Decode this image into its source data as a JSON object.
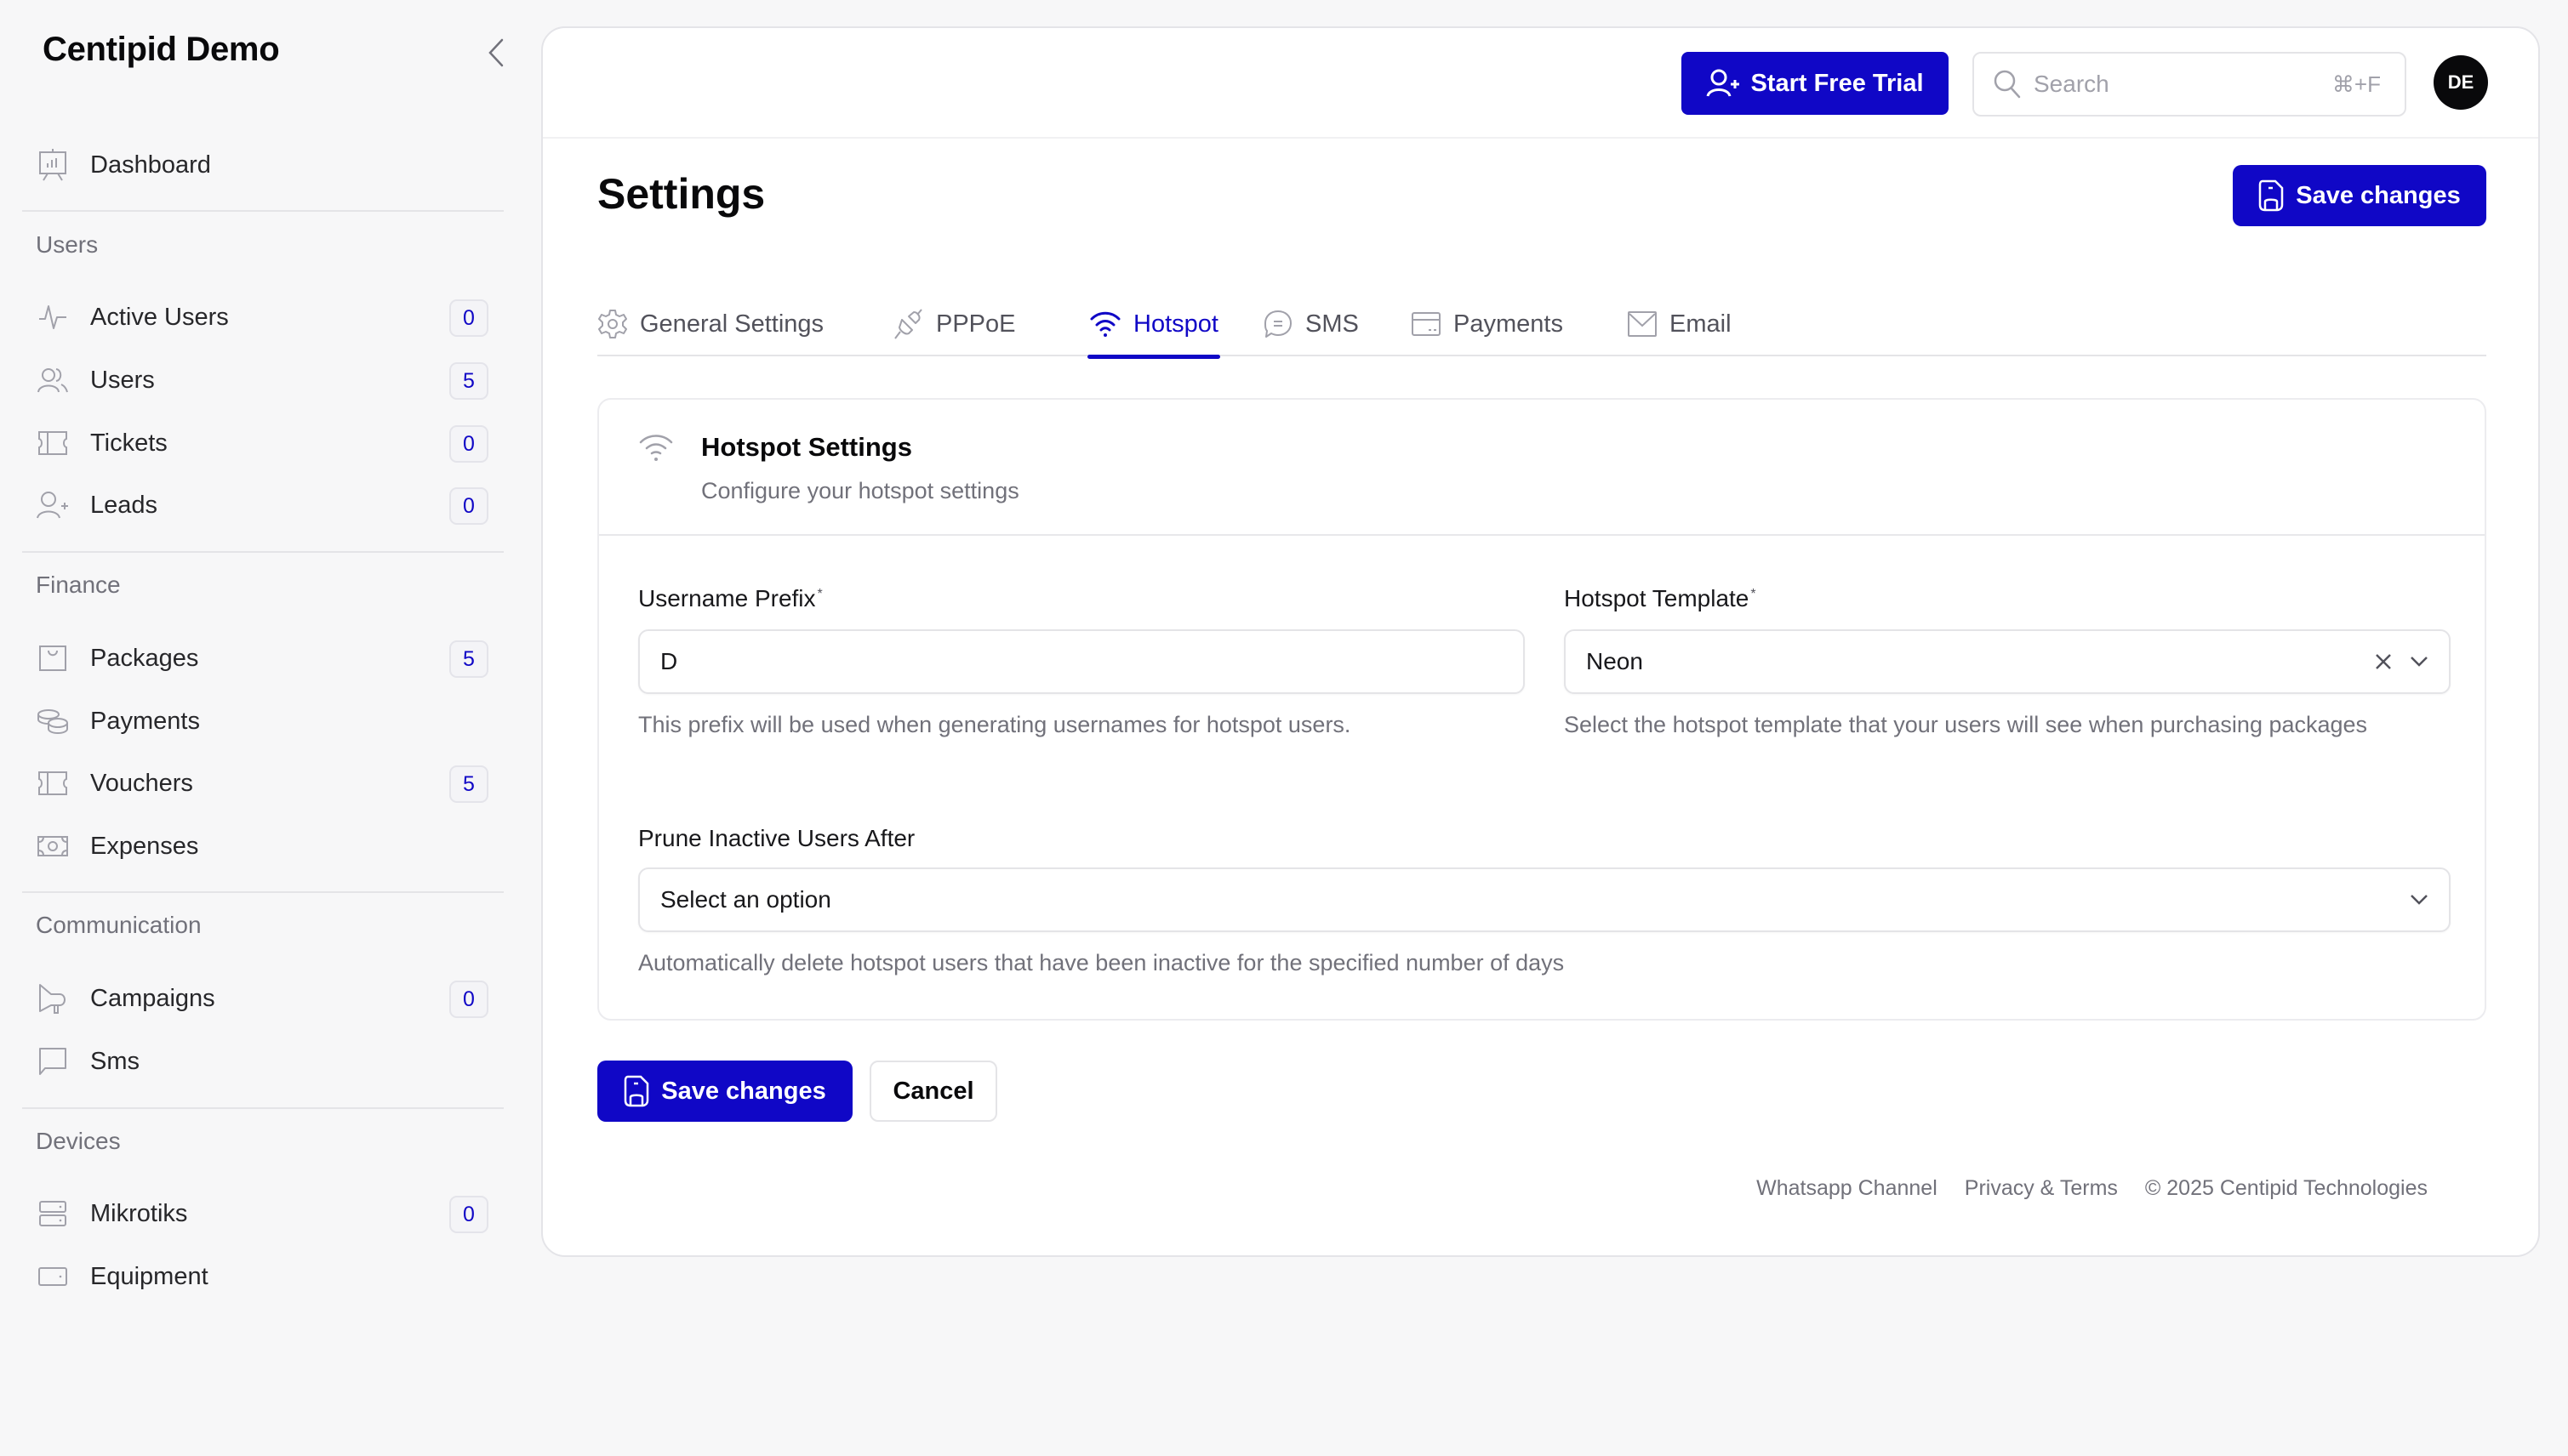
{
  "brand": {
    "title": "Centipid Demo"
  },
  "sidebar": {
    "dashboard": {
      "label": "Dashboard",
      "icon": "presentation-chart-icon"
    },
    "groups": [
      {
        "title": "Users",
        "items": [
          {
            "label": "Active Users",
            "icon": "activity-icon",
            "badge": "0"
          },
          {
            "label": "Users",
            "icon": "users-icon",
            "badge": "5"
          },
          {
            "label": "Tickets",
            "icon": "ticket-icon",
            "badge": "0"
          },
          {
            "label": "Leads",
            "icon": "user-plus-icon",
            "badge": "0"
          }
        ]
      },
      {
        "title": "Finance",
        "items": [
          {
            "label": "Packages",
            "icon": "shopping-bag-icon",
            "badge": "5"
          },
          {
            "label": "Payments",
            "icon": "coins-icon"
          },
          {
            "label": "Vouchers",
            "icon": "ticket-icon",
            "badge": "5"
          },
          {
            "label": "Expenses",
            "icon": "banknote-icon"
          }
        ]
      },
      {
        "title": "Communication",
        "items": [
          {
            "label": "Campaigns",
            "icon": "megaphone-icon",
            "badge": "0"
          },
          {
            "label": "Sms",
            "icon": "message-square-icon"
          }
        ]
      },
      {
        "title": "Devices",
        "items": [
          {
            "label": "Mikrotiks",
            "icon": "server-icon",
            "badge": "0"
          },
          {
            "label": "Equipment",
            "icon": "hard-drive-icon"
          }
        ]
      }
    ]
  },
  "topbar": {
    "trial_label": "Start Free Trial",
    "search_placeholder": "Search",
    "search_shortcut": "⌘+F",
    "avatar_initials": "DE"
  },
  "page": {
    "title": "Settings",
    "save_label": "Save changes"
  },
  "tabs": [
    {
      "label": "General Settings",
      "icon": "gear-icon",
      "active": false
    },
    {
      "label": "PPPoE",
      "icon": "plug-icon",
      "active": false
    },
    {
      "label": "Hotspot",
      "icon": "wifi-icon",
      "active": true
    },
    {
      "label": "SMS",
      "icon": "chat-bubble-icon",
      "active": false
    },
    {
      "label": "Payments",
      "icon": "credit-card-icon",
      "active": false
    },
    {
      "label": "Email",
      "icon": "envelope-icon",
      "active": false
    }
  ],
  "card": {
    "title": "Hotspot Settings",
    "subtitle": "Configure your hotspot settings",
    "fields": {
      "username_prefix": {
        "label": "Username Prefix",
        "required_mark": "*",
        "value": "D",
        "helper": "This prefix will be used when generating usernames for hotspot users."
      },
      "hotspot_template": {
        "label": "Hotspot Template",
        "required_mark": "*",
        "value": "Neon",
        "helper": "Select the hotspot template that your users will see when purchasing packages"
      },
      "prune_inactive": {
        "label": "Prune Inactive Users After",
        "placeholder": "Select an option",
        "helper": "Automatically delete hotspot users that have been inactive for the specified number of days"
      }
    }
  },
  "actions": {
    "save_label": "Save changes",
    "cancel_label": "Cancel"
  },
  "footer": {
    "whatsapp": "Whatsapp Channel",
    "privacy": "Privacy & Terms",
    "copyright": "© 2025 Centipid Technologies"
  },
  "colors": {
    "accent": "#1007c6",
    "badge_text": "#1007c6",
    "muted_text": "#71717a",
    "background": "#f7f7f8"
  }
}
